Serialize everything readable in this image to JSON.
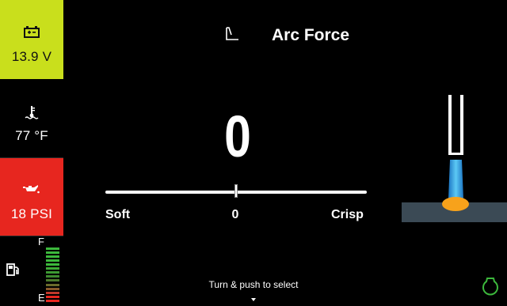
{
  "status": {
    "battery": {
      "icon": "battery-icon",
      "value": "13.9 V",
      "color": "#c9df1c"
    },
    "coolant": {
      "icon": "coolant-temperature-icon",
      "value": "77 °F"
    },
    "oil": {
      "icon": "oil-pressure-icon",
      "value": "18 PSI",
      "color": "#e7261f"
    },
    "fuel": {
      "icon": "fuel-pump-icon",
      "full_label": "F",
      "empty_label": "E",
      "level": 1.0
    }
  },
  "header": {
    "icon": "arc-force-icon",
    "title": "Arc Force"
  },
  "setting": {
    "value": "0",
    "slider": {
      "min_label": "Soft",
      "current_label": "0",
      "max_label": "Crisp",
      "position": 0.5
    }
  },
  "hint": {
    "text": "Turn & push to select",
    "icon": "caret-down-icon"
  },
  "illustration": {
    "icon": "electrode-arc-icon",
    "arc_color": "#2ea8e8",
    "puddle_color": "#f7a21b",
    "workpiece_color": "#3b4a55"
  },
  "footer": {
    "icon": "engine-status-icon",
    "color": "#3cb83c"
  }
}
